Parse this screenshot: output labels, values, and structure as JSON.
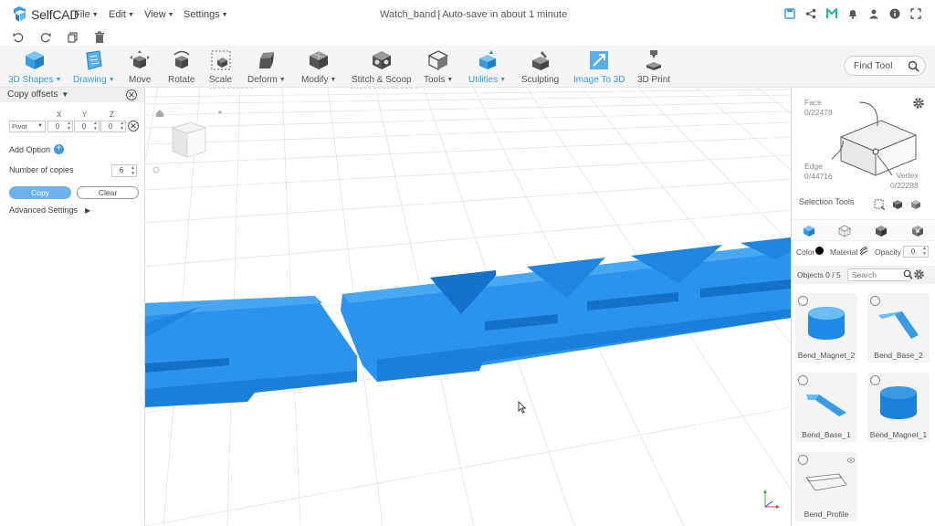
{
  "app": {
    "name": "SelfCAD",
    "menus": [
      "File",
      "Edit",
      "View",
      "Settings"
    ],
    "document_title": "Watch_band",
    "autosave": "Auto-save in about 1 minute"
  },
  "tools": [
    {
      "label": "3D Shapes",
      "caret": true,
      "active": true
    },
    {
      "label": "Drawing",
      "caret": true,
      "active": true
    },
    {
      "label": "Move",
      "caret": false
    },
    {
      "label": "Rotate",
      "caret": false
    },
    {
      "label": "Scale",
      "caret": false
    },
    {
      "label": "Deform",
      "caret": true
    },
    {
      "label": "Modify",
      "caret": true
    },
    {
      "label": "Stitch & Scoop",
      "caret": false
    },
    {
      "label": "Tools",
      "caret": true
    },
    {
      "label": "Utilities",
      "caret": true,
      "active": true
    },
    {
      "label": "Sculpting",
      "caret": false
    },
    {
      "label": "Image To 3D",
      "caret": false,
      "active": true
    },
    {
      "label": "3D Print",
      "caret": false
    }
  ],
  "find_tool": {
    "placeholder": "Find Tool"
  },
  "copy_panel": {
    "title": "Copy offsets",
    "axes": [
      "X",
      "Y",
      "Z"
    ],
    "pivot": "Pivot",
    "offsets": [
      "0",
      "0",
      "0"
    ],
    "add_option": "Add Option",
    "copies_label": "Number of copies",
    "copies_value": "6",
    "copy_button": "Copy",
    "clear_button": "Clear",
    "advanced": "Advanced Settings"
  },
  "selection": {
    "face_label": "Face",
    "face_count": "0/22478",
    "edge_label": "Edge",
    "edge_count": "0/44716",
    "vertex_label": "Vertex",
    "vertex_count": "0/22288",
    "tools_label": "Selection Tools"
  },
  "material_row": {
    "color_label": "Color",
    "material_label": "Material",
    "opacity_label": "Opacity",
    "opacity_value": "0"
  },
  "objects": {
    "label": "Objects 0 / 5",
    "search_placeholder": "Search",
    "items": [
      {
        "name": "Bend_Magnet_2",
        "kind": "cylinder"
      },
      {
        "name": "Bend_Base_2",
        "kind": "strap"
      },
      {
        "name": "Bend_Base_1",
        "kind": "strap"
      },
      {
        "name": "Bend_Magnet_1",
        "kind": "cylinder"
      },
      {
        "name": "Bend_Profile",
        "kind": "profile"
      }
    ]
  },
  "colors": {
    "accent": "#3b9be2",
    "model": "#1a8fe8"
  }
}
